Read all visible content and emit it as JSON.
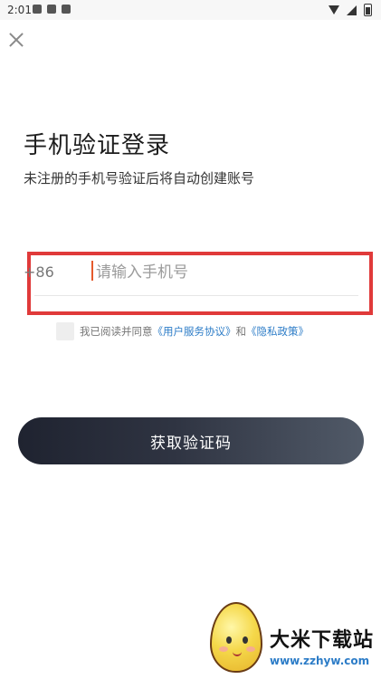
{
  "status_bar": {
    "time": "2:01"
  },
  "title": "手机验证登录",
  "subtitle": "未注册的手机号验证后将自动创建账号",
  "phone": {
    "country_code": "+86",
    "placeholder": "请输入手机号",
    "value": ""
  },
  "agreement": {
    "prefix": "我已阅读并同意",
    "link_terms": "《用户服务协议》",
    "connector": "和",
    "link_privacy": "《隐私政策》"
  },
  "cta_label": "获取验证码",
  "watermark": {
    "site_name": "大米下载站",
    "url": "www.zzhyw.com"
  },
  "colors": {
    "highlight": "#e03a3a",
    "link": "#2c7cc7",
    "cta_start": "#1f2330",
    "cta_end": "#515a68"
  }
}
